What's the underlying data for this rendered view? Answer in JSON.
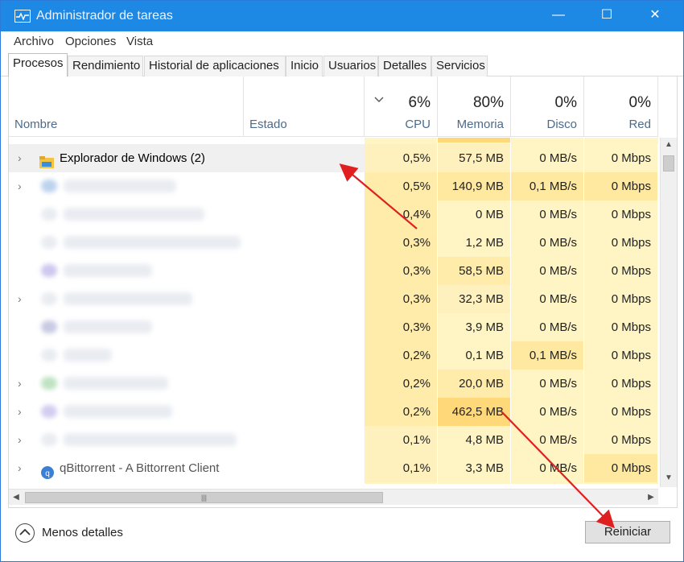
{
  "window": {
    "title": "Administrador de tareas",
    "controls": {
      "minimize": "—",
      "maximize": "☐",
      "close": "✕"
    }
  },
  "menu": {
    "items": [
      "Archivo",
      "Opciones",
      "Vista"
    ]
  },
  "tabs": [
    "Procesos",
    "Rendimiento",
    "Historial de aplicaciones",
    "Inicio",
    "Usuarios",
    "Detalles",
    "Servicios"
  ],
  "columns": {
    "name": "Nombre",
    "status": "Estado",
    "cpu": {
      "pct": "6%",
      "label": "CPU"
    },
    "memory": {
      "pct": "80%",
      "label": "Memoria"
    },
    "disk": {
      "pct": "0%",
      "label": "Disco"
    },
    "network": {
      "pct": "0%",
      "label": "Red"
    }
  },
  "rows": [
    {
      "name": "Explorador de Windows (2)",
      "cpu": "0,5%",
      "mem": "57,5 MB",
      "disk": "0 MB/s",
      "net": "0 Mbps"
    },
    {
      "name": "",
      "cpu": "0,5%",
      "mem": "140,9 MB",
      "disk": "0,1 MB/s",
      "net": "0 Mbps"
    },
    {
      "name": "",
      "cpu": "0,4%",
      "mem": "0 MB",
      "disk": "0 MB/s",
      "net": "0 Mbps"
    },
    {
      "name": "",
      "cpu": "0,3%",
      "mem": "1,2 MB",
      "disk": "0 MB/s",
      "net": "0 Mbps"
    },
    {
      "name": "",
      "cpu": "0,3%",
      "mem": "58,5 MB",
      "disk": "0 MB/s",
      "net": "0 Mbps"
    },
    {
      "name": "",
      "cpu": "0,3%",
      "mem": "32,3 MB",
      "disk": "0 MB/s",
      "net": "0 Mbps"
    },
    {
      "name": "",
      "cpu": "0,3%",
      "mem": "3,9 MB",
      "disk": "0 MB/s",
      "net": "0 Mbps"
    },
    {
      "name": "",
      "cpu": "0,2%",
      "mem": "0,1 MB",
      "disk": "0,1 MB/s",
      "net": "0 Mbps"
    },
    {
      "name": "",
      "cpu": "0,2%",
      "mem": "20,0 MB",
      "disk": "0 MB/s",
      "net": "0 Mbps"
    },
    {
      "name": "",
      "cpu": "0,2%",
      "mem": "462,5 MB",
      "disk": "0 MB/s",
      "net": "0 Mbps"
    },
    {
      "name": "",
      "cpu": "0,1%",
      "mem": "4,8 MB",
      "disk": "0 MB/s",
      "net": "0 Mbps"
    },
    {
      "name": "qBittorrent - A Bittorrent Client",
      "cpu": "0,1%",
      "mem": "3,3 MB",
      "disk": "0 MB/s",
      "net": "0 Mbps"
    }
  ],
  "footer": {
    "less_details": "Menos detalles",
    "restart": "Reiniciar"
  },
  "colors": {
    "titlebar": "#1e88e5",
    "heat_light": "#fff4c4",
    "heat_mid": "#ffe9a1",
    "heat_strong": "#ffd87a",
    "annotation_arrow": "#e02020"
  }
}
